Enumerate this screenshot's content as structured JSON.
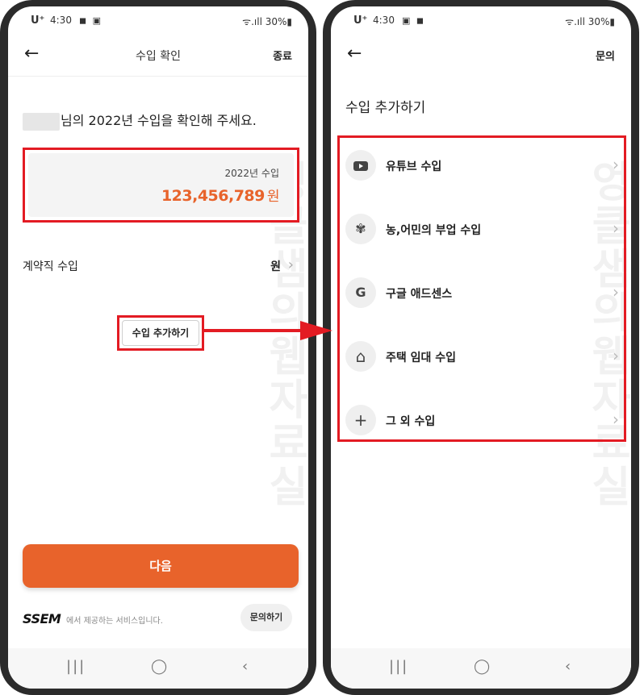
{
  "left": {
    "status": {
      "carrier": "U⁺",
      "time": "4:30",
      "icons": "◼ ▣",
      "right": "ᯤ.ıll 30%▮"
    },
    "appbar": {
      "back": "←",
      "title": "수입 확인",
      "action": "종료"
    },
    "confirm_text": "님의 2022년 수입을 확인해 주세요.",
    "income": {
      "year_label": "2022년 수입",
      "amount": "123,456,789",
      "unit": "원"
    },
    "contract": {
      "label": "계약직 수입",
      "value": "원",
      "chevron": "›"
    },
    "add_button": "수입 추가하기",
    "next_button": "다음",
    "footer": {
      "brand": "SSEM",
      "text": "에서 제공하는 서비스입니다.",
      "inquiry": "문의하기"
    },
    "watermark": "엉클샘의웹자료실",
    "nav": {
      "recent": "|||",
      "home": "◯",
      "back": "‹"
    }
  },
  "right": {
    "status": {
      "carrier": "U⁺",
      "time": "4:30",
      "icons": "▣ ◼",
      "right": "ᯤ.ıll 30%▮"
    },
    "appbar": {
      "back": "←",
      "action": "문의"
    },
    "heading": "수입 추가하기",
    "items": [
      {
        "label": "유튜브 수입",
        "icon": "youtube-icon",
        "glyph": ""
      },
      {
        "label": "농,어민의 부업 수입",
        "icon": "sprout-icon",
        "glyph": "✾"
      },
      {
        "label": "구글 애드센스",
        "icon": "google-icon",
        "glyph": "G"
      },
      {
        "label": "주택 임대 수입",
        "icon": "house-icon",
        "glyph": "⌂"
      },
      {
        "label": "그 외 수입",
        "icon": "plus-icon",
        "glyph": "+"
      }
    ],
    "chevron": "›",
    "watermark": "엉클샘의웹자료실",
    "nav": {
      "recent": "|||",
      "home": "◯",
      "back": "‹"
    }
  },
  "colors": {
    "accent": "#e8632b",
    "highlight": "#e31b23"
  }
}
